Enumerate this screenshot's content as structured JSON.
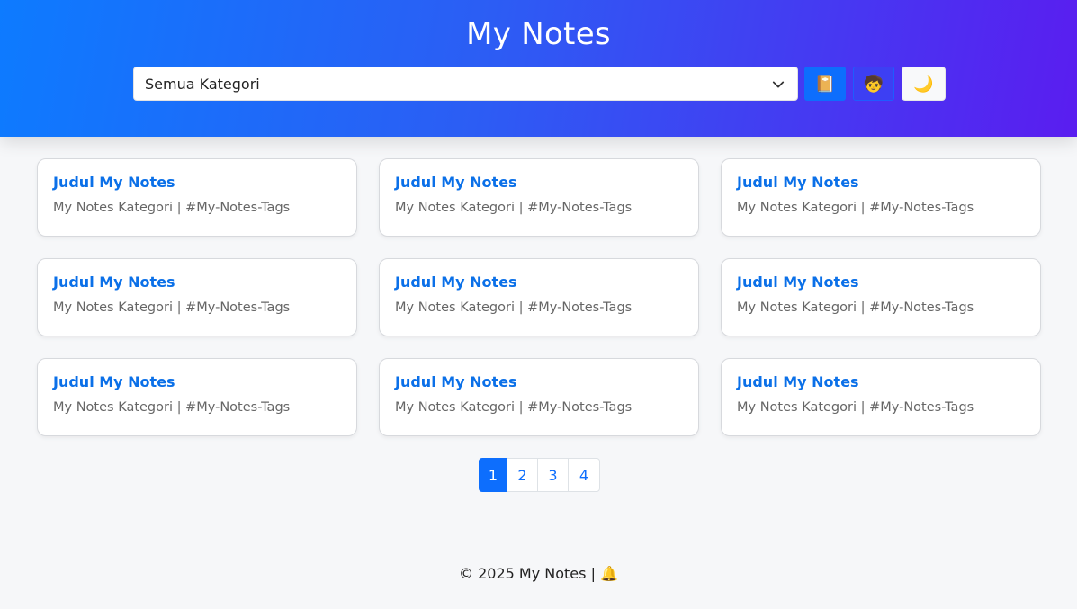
{
  "header": {
    "title": "My Notes",
    "category_select": {
      "selected": "Semua Kategori"
    },
    "buttons": [
      {
        "icon": "notebook-icon",
        "glyph": "📔"
      },
      {
        "icon": "profile-icon",
        "glyph": "🧒"
      },
      {
        "icon": "moon-icon",
        "glyph": "🌙"
      }
    ]
  },
  "notes": [
    {
      "title": "Judul My Notes",
      "meta": "My Notes Kategori | #My-Notes-Tags"
    },
    {
      "title": "Judul My Notes",
      "meta": "My Notes Kategori | #My-Notes-Tags"
    },
    {
      "title": "Judul My Notes",
      "meta": "My Notes Kategori | #My-Notes-Tags"
    },
    {
      "title": "Judul My Notes",
      "meta": "My Notes Kategori | #My-Notes-Tags"
    },
    {
      "title": "Judul My Notes",
      "meta": "My Notes Kategori | #My-Notes-Tags"
    },
    {
      "title": "Judul My Notes",
      "meta": "My Notes Kategori | #My-Notes-Tags"
    },
    {
      "title": "Judul My Notes",
      "meta": "My Notes Kategori | #My-Notes-Tags"
    },
    {
      "title": "Judul My Notes",
      "meta": "My Notes Kategori | #My-Notes-Tags"
    },
    {
      "title": "Judul My Notes",
      "meta": "My Notes Kategori | #My-Notes-Tags"
    }
  ],
  "pagination": {
    "pages": [
      "1",
      "2",
      "3",
      "4"
    ],
    "active": "1"
  },
  "footer": {
    "text": "© 2025 My Notes | ",
    "icon": "bell-icon",
    "glyph": "🔔"
  },
  "colors": {
    "accent": "#0d6efd",
    "card_title": "#0b70e8",
    "header_gradient_start": "#0d7bff",
    "header_gradient_end": "#5a1df0"
  }
}
